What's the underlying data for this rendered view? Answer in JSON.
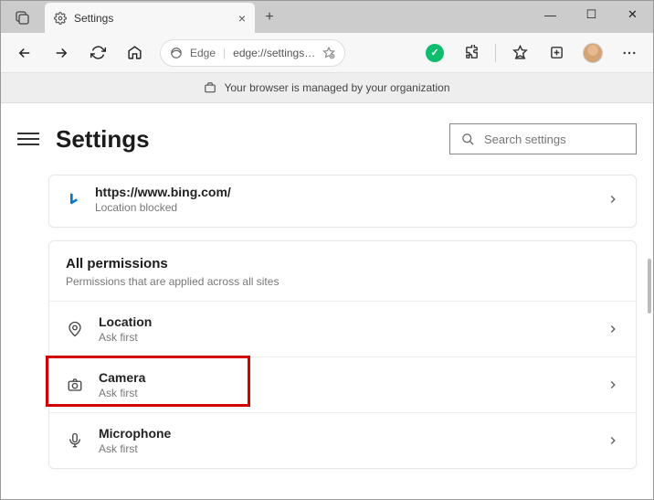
{
  "titlebar": {
    "tab_title": "Settings",
    "close_glyph": "×",
    "newtab_glyph": "+",
    "minimize": "—",
    "maximize": "☐",
    "closewin": "✕"
  },
  "toolbar": {
    "edge_label": "Edge",
    "url": "edge://settings…",
    "grammarly_glyph": "✓"
  },
  "org_banner": {
    "text": "Your browser is managed by your organization"
  },
  "header": {
    "title": "Settings",
    "search_placeholder": "Search settings"
  },
  "recent": {
    "url": "https://www.bing.com/",
    "status": "Location blocked"
  },
  "all_permissions": {
    "title": "All permissions",
    "subtitle": "Permissions that are applied across all sites",
    "items": [
      {
        "name": "Location",
        "status": "Ask first",
        "icon": "location-icon",
        "highlight": false
      },
      {
        "name": "Camera",
        "status": "Ask first",
        "icon": "camera-icon",
        "highlight": true
      },
      {
        "name": "Microphone",
        "status": "Ask first",
        "icon": "microphone-icon",
        "highlight": false
      }
    ]
  }
}
